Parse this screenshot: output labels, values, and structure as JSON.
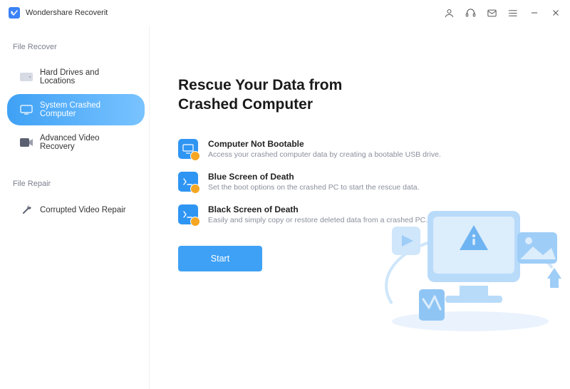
{
  "app": {
    "title": "Wondershare Recoverit"
  },
  "sidebar": {
    "sections": [
      {
        "heading": "File Recover",
        "items": [
          {
            "label": "Hard Drives and Locations",
            "active": false
          },
          {
            "label": "System Crashed Computer",
            "active": true
          },
          {
            "label": "Advanced Video Recovery",
            "active": false
          }
        ]
      },
      {
        "heading": "File Repair",
        "items": [
          {
            "label": "Corrupted Video Repair",
            "active": false
          }
        ]
      }
    ]
  },
  "main": {
    "title": "Rescue Your Data from Crashed Computer",
    "features": [
      {
        "title": "Computer Not Bootable",
        "desc": "Access your crashed computer data by creating a bootable USB drive."
      },
      {
        "title": "Blue Screen of Death",
        "desc": "Set the boot options on the crashed PC to start the rescue data."
      },
      {
        "title": "Black Screen of Death",
        "desc": "Easily and simply copy or restore deleted data from a crashed PC."
      }
    ],
    "start_label": "Start"
  }
}
